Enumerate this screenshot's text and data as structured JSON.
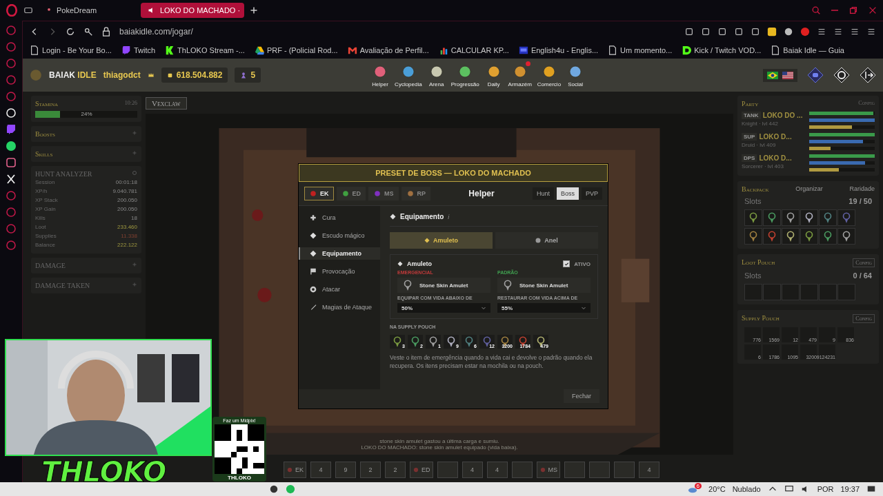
{
  "browser": {
    "tabs": [
      {
        "label": "PokeDream",
        "selected": false
      },
      {
        "label": "LOKO DO MACHADO ·",
        "selected": true
      }
    ],
    "url": "baiakidle.com/jogar/",
    "bookmarks": [
      {
        "label": "Login - Be Your Bo...",
        "kind": "page"
      },
      {
        "label": "Twitch",
        "kind": "twitch"
      },
      {
        "label": "ThLOKO Stream -...",
        "kind": "k"
      },
      {
        "label": "PRF - (Policial Rod...",
        "kind": "drive"
      },
      {
        "label": "Avaliação de Perfil...",
        "kind": "mail"
      },
      {
        "label": "CALCULAR KP...",
        "kind": "sheet"
      },
      {
        "label": "English4u - Englis...",
        "kind": "badge"
      },
      {
        "label": "Um momento...",
        "kind": "page"
      },
      {
        "label": "Kick / Twitch VOD...",
        "kind": "d"
      },
      {
        "label": "Baiak Idle — Guia",
        "kind": "page"
      }
    ]
  },
  "game": {
    "header": {
      "brand": [
        "BAIAK",
        "IDLE"
      ],
      "player": "thiagodct",
      "gold": "618.504.882",
      "points": "5",
      "nav": [
        {
          "label": "Helper",
          "alert": false
        },
        {
          "label": "Cyclopedia",
          "alert": false
        },
        {
          "label": "Arena",
          "alert": false
        },
        {
          "label": "Progressão",
          "alert": false
        },
        {
          "label": "Daily",
          "alert": false
        },
        {
          "label": "Armazém",
          "alert": true
        },
        {
          "label": "Comercio",
          "alert": false
        },
        {
          "label": "Social",
          "alert": false
        }
      ]
    },
    "left": {
      "stamina": {
        "title": "Stamina",
        "time": "10:26",
        "level": 0.24,
        "reading": "24%"
      },
      "collapsed": [
        "Boosts",
        "Skills"
      ],
      "hunt": {
        "title": "HUNT ANALYZER",
        "rows": [
          {
            "label": "Session",
            "value": "00:01:18",
            "kind": "plain"
          },
          {
            "label": "XP/h",
            "value": "9.040.781",
            "kind": "plain"
          },
          {
            "label": "XP Stack",
            "value": "200.050",
            "kind": "plain"
          },
          {
            "label": "XP Gain",
            "value": "200.050",
            "kind": "plain"
          },
          {
            "label": "Kills",
            "value": "18",
            "kind": "plain"
          },
          {
            "label": "Loot",
            "value": "233.460",
            "kind": "gain"
          },
          {
            "label": "Supplies",
            "value": "11.338",
            "kind": "loss"
          },
          {
            "label": "Balance",
            "value": "222.122",
            "kind": "gain"
          }
        ]
      },
      "trackers": [
        "DAMAGE",
        "DAMAGE TAKEN"
      ]
    },
    "center": {
      "character": "Vexclaw",
      "chat": [
        "stone skin amulet gastou a última carga e sumiu.",
        "LOKO DO MACHADO: stone skin amulet equipado (vida baixa)."
      ],
      "hotbar": [
        {
          "kind": "class",
          "label": "EK"
        },
        {
          "kind": "slot",
          "label": "4"
        },
        {
          "kind": "slot",
          "label": "9"
        },
        {
          "kind": "slot",
          "label": "2"
        },
        {
          "kind": "slot",
          "label": "2"
        },
        {
          "kind": "class",
          "label": "ED"
        },
        {
          "kind": "slot"
        },
        {
          "kind": "slot",
          "label": "4"
        },
        {
          "kind": "slot",
          "label": "4"
        },
        {
          "kind": "slot"
        },
        {
          "kind": "class",
          "label": "MS"
        },
        {
          "kind": "slot"
        },
        {
          "kind": "slot"
        },
        {
          "kind": "slot"
        },
        {
          "kind": "slot",
          "label": "4"
        }
      ]
    },
    "right": {
      "party": {
        "title": "Party",
        "config": "Config",
        "members": [
          {
            "role": "TANK",
            "name": "LOKO DO ...",
            "info": "Knight · lvl 442",
            "bars": [
              {
                "kind": "hp",
                "level": 0.98
              },
              {
                "kind": "mana",
                "level": 1
              },
              {
                "kind": "stamina",
                "level": 0.65
              }
            ]
          },
          {
            "role": "SUP",
            "name": "LOKO D...",
            "info": "Druid · lvl 409",
            "bars": [
              {
                "kind": "hp",
                "level": 1
              },
              {
                "kind": "mana",
                "level": 0.82
              },
              {
                "kind": "stamina",
                "level": 0.33
              }
            ]
          },
          {
            "role": "DPS",
            "name": "LOKO D...",
            "info": "Sorcerer · lvl 403",
            "bars": [
              {
                "kind": "hp",
                "level": 1
              },
              {
                "kind": "mana",
                "level": 0.85
              },
              {
                "kind": "stamina",
                "level": 0.45
              }
            ]
          }
        ]
      },
      "backpack": {
        "title": "Backpack",
        "actions": [
          "Organizar",
          "Raridade"
        ],
        "slots_label": "Slots",
        "slots": "19 / 50"
      },
      "loot_pouch": {
        "title": "Loot Pouch",
        "config": "Config",
        "slots_label": "Slots",
        "slots": "0 / 64"
      },
      "supply_pouch": {
        "title": "Supply Pouch",
        "config": "Config",
        "counts": [
          "776",
          "1569",
          "12",
          "479",
          "9",
          "836",
          "6",
          "1786",
          "1095",
          "3200",
          "9124231"
        ]
      }
    }
  },
  "modal": {
    "title": "PRESET DE BOSS — LOKO DO MACHADO",
    "classes": [
      {
        "label": "EK",
        "selected": true
      },
      {
        "label": "ED",
        "selected": false
      },
      {
        "label": "MS",
        "selected": false
      },
      {
        "label": "RP",
        "selected": false
      }
    ],
    "heading": "Helper",
    "modes": [
      {
        "label": "Hunt",
        "selected": false
      },
      {
        "label": "Boss",
        "selected": true
      },
      {
        "label": "PVP",
        "selected": false
      }
    ],
    "menu": [
      {
        "label": "Cura",
        "selected": false
      },
      {
        "label": "Escudo mágico",
        "selected": false
      },
      {
        "label": "Equipamento",
        "selected": true
      },
      {
        "label": "Provocação",
        "selected": false
      },
      {
        "label": "Atacar",
        "selected": false
      },
      {
        "label": "Magias de Ataque",
        "selected": false
      }
    ],
    "section": "Equipamento",
    "info": "i",
    "item_tabs": [
      {
        "label": "Amuleto",
        "selected": true
      },
      {
        "label": "Anel",
        "selected": false
      }
    ],
    "card": {
      "title": "Amuleto",
      "active_label": "ATIVO",
      "active": true,
      "emergency": {
        "label": "EMERGENCIAL",
        "item": "Stone Skin Amulet",
        "threshold_label": "EQUIPAR COM VIDA ABAIXO DE",
        "threshold": "50%"
      },
      "default": {
        "label": "PADRÃO",
        "item": "Stone Skin Amulet",
        "threshold_label": "RESTAURAR COM VIDA ACIMA DE",
        "threshold": "55%"
      }
    },
    "pouch_label": "NA SUPPLY POUCH",
    "pouch": [
      "3",
      "2",
      "1",
      "9",
      "6",
      "12",
      "3200",
      "1784",
      "479"
    ],
    "help": "Veste o item de emergência quando a vida cai e devolve o padrão quando ela recupera. Os itens precisam estar na mochila ou na pouch.",
    "close": "Fechar"
  },
  "overlay": {
    "qr_caption": "Faz um Midpix!",
    "qr_name": "THLOKO",
    "logo": "THLOKO"
  },
  "taskbar": {
    "notifications": "6",
    "temperature": "20°C",
    "weather": "Nublado",
    "language": "POR",
    "time": "19:37"
  }
}
